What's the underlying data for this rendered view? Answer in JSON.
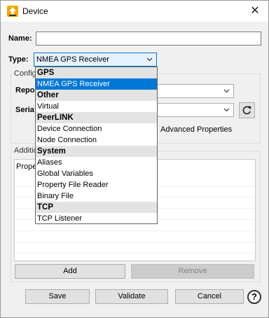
{
  "window": {
    "title": "Device"
  },
  "form": {
    "name_label": "Name:",
    "name_value": "",
    "type_label": "Type:",
    "type_value": "NMEA GPS Receiver"
  },
  "config": {
    "legend": "Config",
    "report_label": "Repo",
    "serial_label": "Seria",
    "advanced_properties_label": "Advanced Properties"
  },
  "additional": {
    "legend": "Additio",
    "column_header": "Prope"
  },
  "dropdown": {
    "items": [
      {
        "label": "GPS",
        "kind": "header"
      },
      {
        "label": "NMEA GPS Receiver",
        "kind": "selected"
      },
      {
        "label": "Other",
        "kind": "header"
      },
      {
        "label": "Virtual",
        "kind": "item"
      },
      {
        "label": "PeerLINK",
        "kind": "header"
      },
      {
        "label": "Device Connection",
        "kind": "item"
      },
      {
        "label": "Node Connection",
        "kind": "item"
      },
      {
        "label": "System",
        "kind": "header"
      },
      {
        "label": "Aliases",
        "kind": "item"
      },
      {
        "label": "Global Variables",
        "kind": "item"
      },
      {
        "label": "Property File Reader",
        "kind": "item"
      },
      {
        "label": "Binary File",
        "kind": "item"
      },
      {
        "label": "TCP",
        "kind": "header"
      },
      {
        "label": "TCP Listener",
        "kind": "item"
      }
    ]
  },
  "buttons": {
    "add": "Add",
    "remove": "Remove",
    "save": "Save",
    "validate": "Validate",
    "cancel": "Cancel",
    "help": "?"
  },
  "icons": {
    "app": "device-app-icon",
    "close": "close-icon",
    "refresh": "refresh-icon",
    "help": "help-icon"
  }
}
